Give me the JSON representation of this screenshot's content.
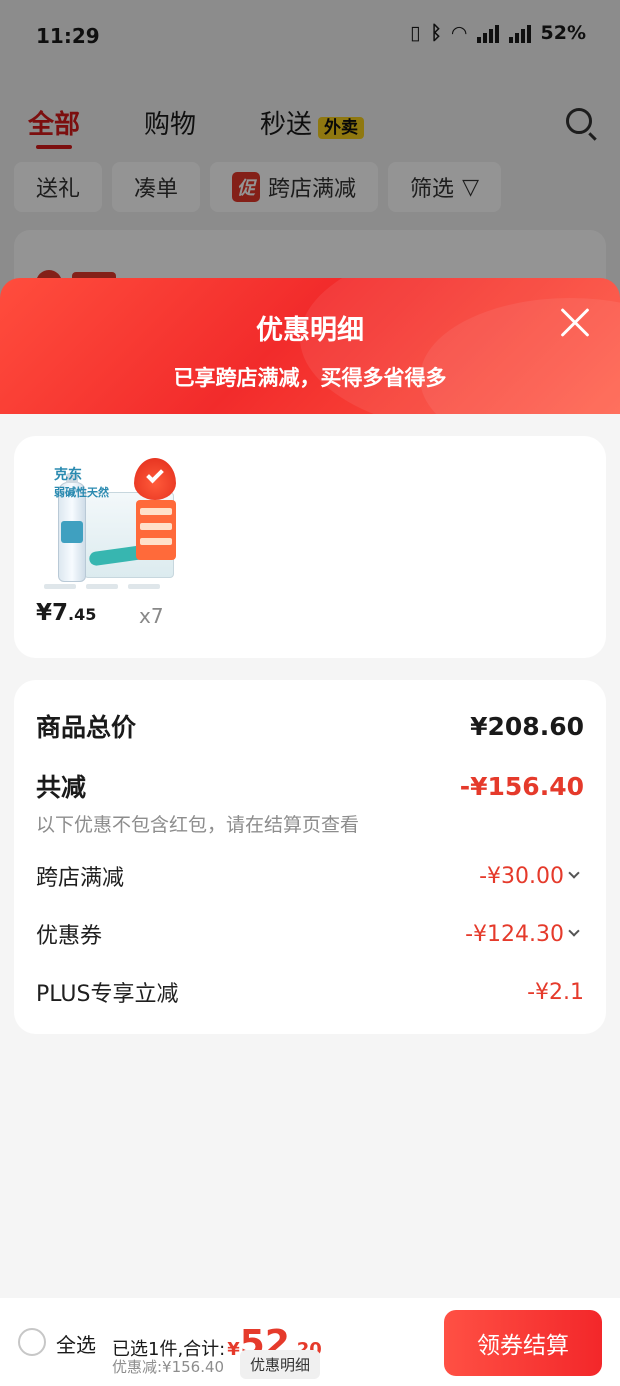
{
  "status_bar": {
    "time": "11:29",
    "network1": "5G",
    "network2": "5G",
    "battery": "52%"
  },
  "top_tabs": [
    {
      "label": "全部"
    },
    {
      "label": "购物"
    },
    {
      "label": "秒送",
      "badge": "外卖"
    }
  ],
  "chips": [
    {
      "label": "送礼"
    },
    {
      "label": "凑单"
    },
    {
      "badge": "促",
      "label": "跨店满减"
    },
    {
      "label": "筛选"
    }
  ],
  "sheet": {
    "title": "优惠明细",
    "subtitle": "已享跨店满减，买得多省得多"
  },
  "product": {
    "image_brand": "克东",
    "image_subtitle": "弱碱性天然",
    "price_yen": "¥",
    "price_int": "7",
    "price_dec": ".45",
    "quantity": "x7"
  },
  "summary": {
    "total_label": "商品总价",
    "total_value": "¥208.60",
    "minus_label": "共减",
    "minus_value": "-¥156.40",
    "note": "以下优惠不包含红包，请在结算页查看",
    "details": [
      {
        "label": "跨店满减",
        "value": "-¥30.00",
        "expandable": true
      },
      {
        "label": "优惠券",
        "value": "-¥124.30",
        "expandable": true
      },
      {
        "label": "PLUS专享立减",
        "value": "-¥2.1",
        "expandable": false
      }
    ]
  },
  "bottom_bar": {
    "select_all": "全选",
    "selected_prefix": "已选1件,合计:",
    "total_yen": "¥",
    "total_int": "52",
    "total_dec": ".20",
    "discount": "优惠减:¥156.40",
    "detail_link": "优惠明细",
    "checkout": "领券结算"
  },
  "colors": {
    "accent": "#e53a2b",
    "header_red": "#f22b2b",
    "waimai_yellow": "#f6cf1c"
  }
}
